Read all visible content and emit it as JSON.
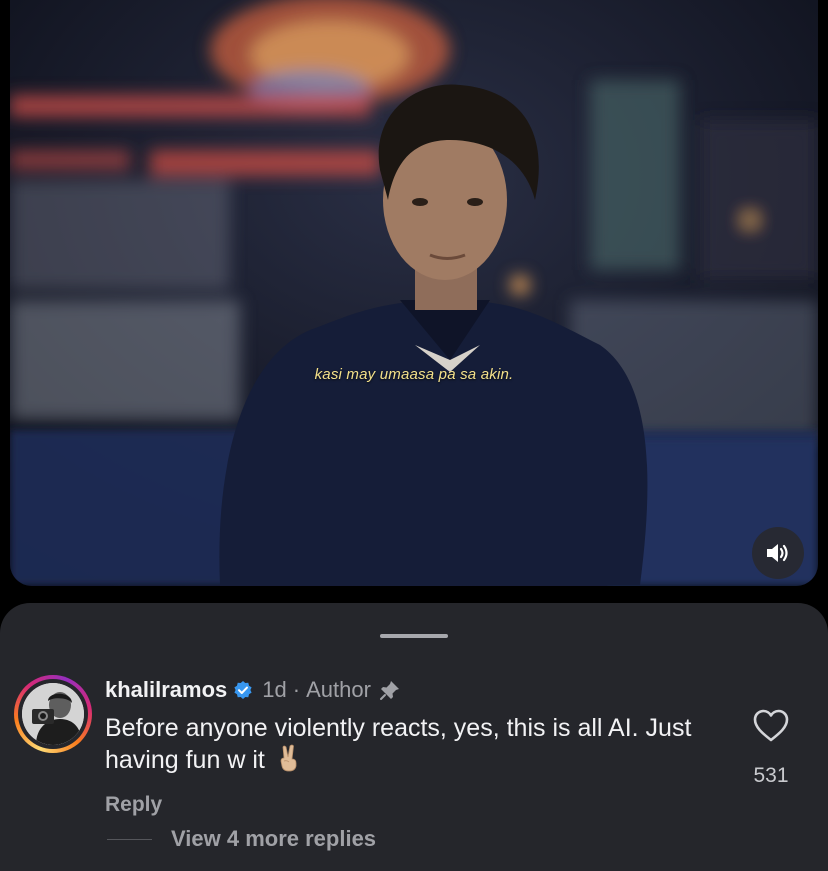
{
  "video": {
    "subtitle": "kasi may umaasa pa sa akin.",
    "mute_icon": "speaker-volume-icon"
  },
  "comment": {
    "username": "khalilramos",
    "verified_icon": "verified-badge-icon",
    "time": "1d",
    "separator": "·",
    "role": "Author",
    "pin_icon": "pin-icon",
    "text": "Before anyone violently reacts, yes, this is all AI. Just having fun w it",
    "emoji": "peace-hand-emoji",
    "like_icon": "heart-outline-icon",
    "like_count": "531",
    "reply_label": "Reply",
    "view_replies_label": "View 4 more replies"
  },
  "colors": {
    "sheet_bg": "#25262b",
    "text_primary": "#f2f2f4",
    "text_secondary": "#a0a1a6",
    "verified": "#3897f0",
    "subtitle": "#f3e08a"
  }
}
